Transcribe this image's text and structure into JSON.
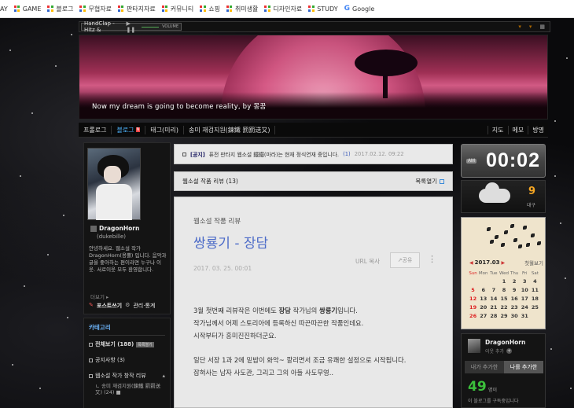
{
  "bookmarks": [
    {
      "label": "AY",
      "dots": false
    },
    {
      "label": "GAME",
      "dots": true
    },
    {
      "label": "블로그",
      "dots": true
    },
    {
      "label": "무협자료",
      "dots": true
    },
    {
      "label": "판타지자료",
      "dots": true
    },
    {
      "label": "커뮤니티",
      "dots": true
    },
    {
      "label": "쇼핑",
      "dots": true
    },
    {
      "label": "취미생활",
      "dots": true
    },
    {
      "label": "디자인자료",
      "dots": true
    },
    {
      "label": "STUDY",
      "dots": true
    },
    {
      "label": "Google",
      "dots": false
    }
  ],
  "player": {
    "title": "HandClap - Hitz &",
    "volume_label": "VOLUME"
  },
  "banner": {
    "text": "Now my dream is going to become reality, by 몽꿈"
  },
  "nav": {
    "items": [
      "프롤로그",
      "블로그",
      "태그(미리)",
      "송미 재검지원(鍊鐵 罰罰送又)"
    ],
    "active_index": 1,
    "new_badge": "N",
    "right": [
      "지도",
      "메모",
      "방명"
    ]
  },
  "profile": {
    "name": "DragonHorn",
    "id": "(dukebille)",
    "desc": "안녕하세요. 웹소설 작가 DragonHorn(용뿔) 입니다. 음악과 글을 좋아하는 편이라면 누구나 이웃. 서로이웃 모두 환영합니다.",
    "more": "더보기 ▸",
    "post_write": "포스트쓰기",
    "manage": "관리·통계"
  },
  "category": {
    "title": "카테고리",
    "items": [
      {
        "label": "전체보기 (188)",
        "badge": "목록열기"
      },
      {
        "label": "공지사항 (3)"
      },
      {
        "label": "웹소설 작가 창작 리뷰"
      }
    ],
    "sub": "ㄴ 송미 재검지원(鍊鐵 罰罰送又) (24) ■"
  },
  "notice": {
    "tag": "[공지]",
    "text": "퓨전 판타지 웹소설 鐵鐵(마라)는 현재 정식연재 중입니다.",
    "count": "(1)",
    "date": "2017.02.12. 09:22"
  },
  "listbar": {
    "title": "웹소설 작품 리뷰 (13)",
    "toggle": "목록열기"
  },
  "post": {
    "category": "웹소설 작품 리뷰",
    "title": "쌍룡기 - 장담",
    "date": "2017. 03. 25. 00:01",
    "url_copy": "URL 복사",
    "share": "↗공유",
    "more": "⋮",
    "para1_a": "3월 첫번째 리뷰작은 이번에도 ",
    "para1_b": "장담",
    "para1_c": " 작가님의 ",
    "para1_d": "쌍룡기",
    "para1_e": "입니다.",
    "para2": "작가님께서 어제 스토리아에 등록하신 따끈따끈한 작품인데요.",
    "para3": "시작부터가 흥미진진하더군요.",
    "para4": "일단 서장 1과 2에 밑밥이 화악~ 깔리면서 조금 유쾌한 설정으로 시작됩니다.",
    "para5": "잡혀사는 남자 사도관, 그리고 그의 아들 사도무영.."
  },
  "clock": {
    "ampm": "AM",
    "time": "00:02"
  },
  "weather": {
    "temp": "9",
    "loc": "대구"
  },
  "calendar": {
    "month": "2017.03",
    "prev": "◀",
    "next": "▶",
    "today": "첫월보기",
    "weekdays": [
      "Sun",
      "Mon",
      "Tue",
      "Wed",
      "Thu",
      "Fri",
      "Sat"
    ],
    "days": [
      "",
      "",
      "",
      "1",
      "2",
      "3",
      "4",
      "5",
      "6",
      "7",
      "8",
      "9",
      "10",
      "11",
      "12",
      "13",
      "14",
      "15",
      "16",
      "17",
      "18",
      "19",
      "20",
      "21",
      "22",
      "23",
      "24",
      "25",
      "26",
      "27",
      "28",
      "29",
      "30",
      "31",
      ""
    ]
  },
  "visitor": {
    "name": "DragonHorn",
    "sub": "이웃 추가",
    "tabs": [
      "내가 추가한",
      "나를 추가한"
    ],
    "active_tab": 1,
    "count": "49",
    "unit": "명이",
    "footer": "이 블로그를 구독중입니다"
  }
}
